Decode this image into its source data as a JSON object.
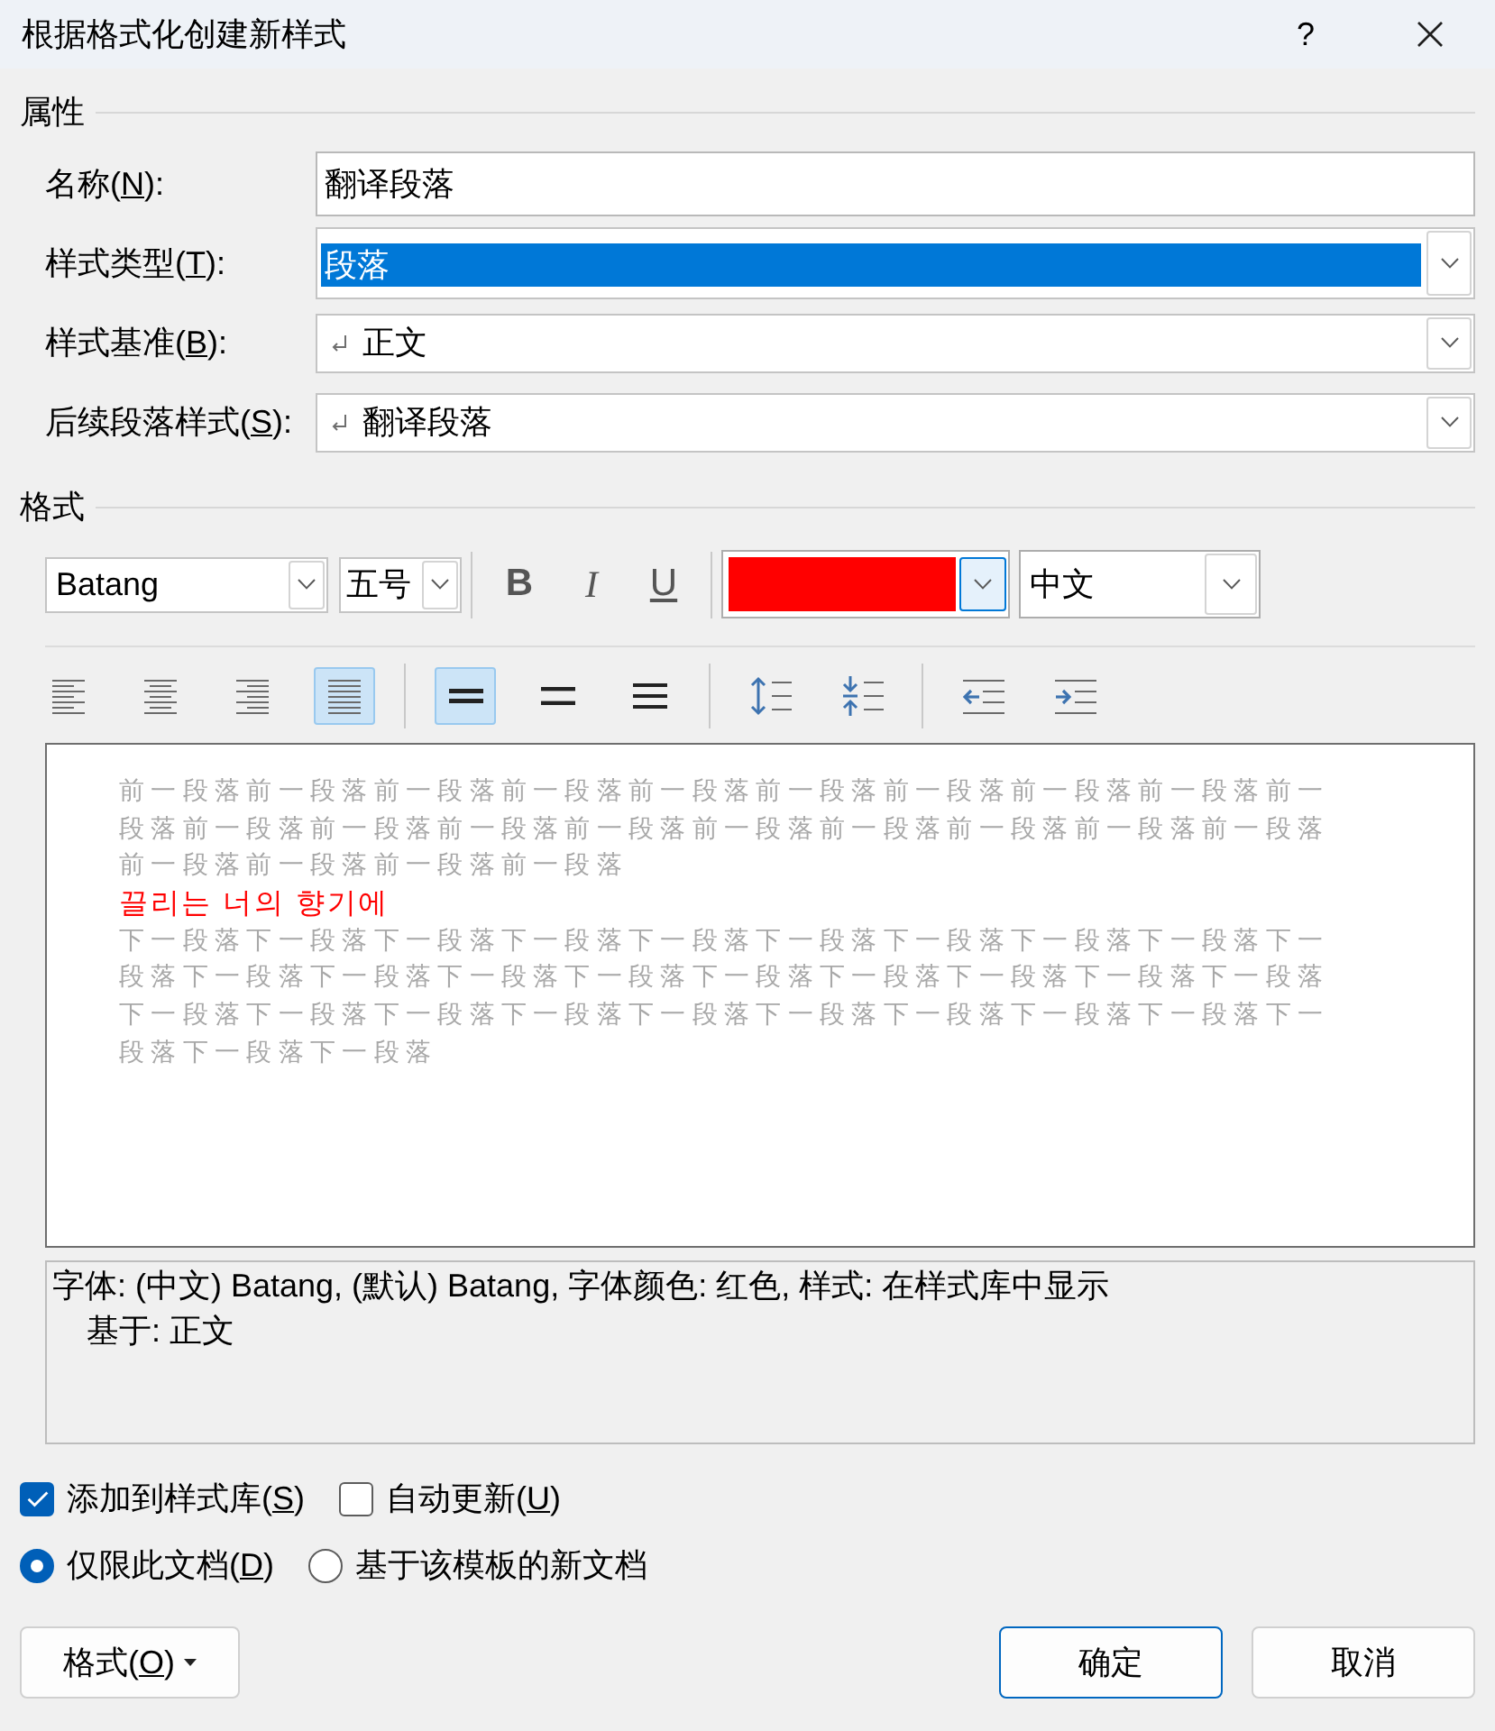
{
  "window": {
    "title": "根据格式化创建新样式",
    "help": "?"
  },
  "properties": {
    "heading": "属性",
    "fields": [
      {
        "kind": "text",
        "label": "名称(",
        "access_key": "N",
        "label_end": "):",
        "value": "翻译段落",
        "text_selected": false,
        "paragraph_mark": false
      },
      {
        "kind": "dropdown",
        "label": "样式类型(",
        "access_key": "T",
        "label_end": "):",
        "value": "段落",
        "text_selected": true,
        "paragraph_mark": false
      },
      {
        "kind": "dropdown",
        "label": "样式基准(",
        "access_key": "B",
        "label_end": "):",
        "value": "正文",
        "text_selected": false,
        "paragraph_mark": true
      },
      {
        "kind": "dropdown",
        "label": "后续段落样式(",
        "access_key": "S",
        "label_end": "):",
        "value": "翻译段落",
        "text_selected": false,
        "paragraph_mark": true
      }
    ]
  },
  "format": {
    "heading": "格式",
    "font": "Batang",
    "size": "五号",
    "text_styles": [
      {
        "kind": "bold",
        "glyph": "B",
        "selected": false
      },
      {
        "kind": "italic",
        "glyph": "I",
        "selected": false
      },
      {
        "kind": "underline",
        "glyph": "U",
        "selected": false
      }
    ],
    "font_color": {
      "color": "#ff0000",
      "dropdown_focused": true
    },
    "language": "中文",
    "alignment": [
      {
        "kind": "left",
        "selected": false
      },
      {
        "kind": "center",
        "selected": false
      },
      {
        "kind": "right",
        "selected": false
      },
      {
        "kind": "justify",
        "selected": true
      }
    ],
    "line_spacing": [
      {
        "kind": "single",
        "selected": true
      },
      {
        "kind": "one_and_half",
        "selected": false
      },
      {
        "kind": "double",
        "selected": false
      }
    ],
    "paragraph_spacing": [
      {
        "kind": "increase"
      },
      {
        "kind": "decrease"
      }
    ],
    "indent": [
      {
        "kind": "decrease"
      },
      {
        "kind": "increase"
      }
    ]
  },
  "preview": {
    "previous_paragraph": "前一段落前一段落前一段落前一段落前一段落前一段落前一段落前一段落前一段落前一段落前一段落前一段落前一段落前一段落前一段落前一段落前一段落前一段落前一段落前一段落前一段落前一段落前一段落",
    "sample": "끌리는 너의 향기에",
    "next_paragraph": "下一段落下一段落下一段落下一段落下一段落下一段落下一段落下一段落下一段落下一段落下一段落下一段落下一段落下一段落下一段落下一段落下一段落下一段落下一段落下一段落下一段落下一段落下一段落下一段落下一段落下一段落下一段落下一段落下一段落下一段落下一段落"
  },
  "description": {
    "summary": "字体: (中文) Batang, (默认) Batang, 字体颜色: 红色, 样式: 在样式库中显示",
    "based_on": "基于: 正文"
  },
  "options": {
    "checkboxes": [
      {
        "label": "添加到样式库(",
        "access_key": "S",
        "label_end": ")",
        "checked": true
      },
      {
        "label": "自动更新(",
        "access_key": "U",
        "label_end": ")",
        "checked": false
      }
    ],
    "radios": [
      {
        "label": "仅限此文档(",
        "access_key": "D",
        "label_end": ")",
        "selected": true
      },
      {
        "label": "基于该模板的新文档",
        "selected": false
      }
    ]
  },
  "buttons": {
    "format": {
      "label": "格式(",
      "access_key": "O",
      "label_end": ")"
    },
    "actions": [
      {
        "label": "确定",
        "default": true
      },
      {
        "label": "取消",
        "default": false
      }
    ]
  }
}
